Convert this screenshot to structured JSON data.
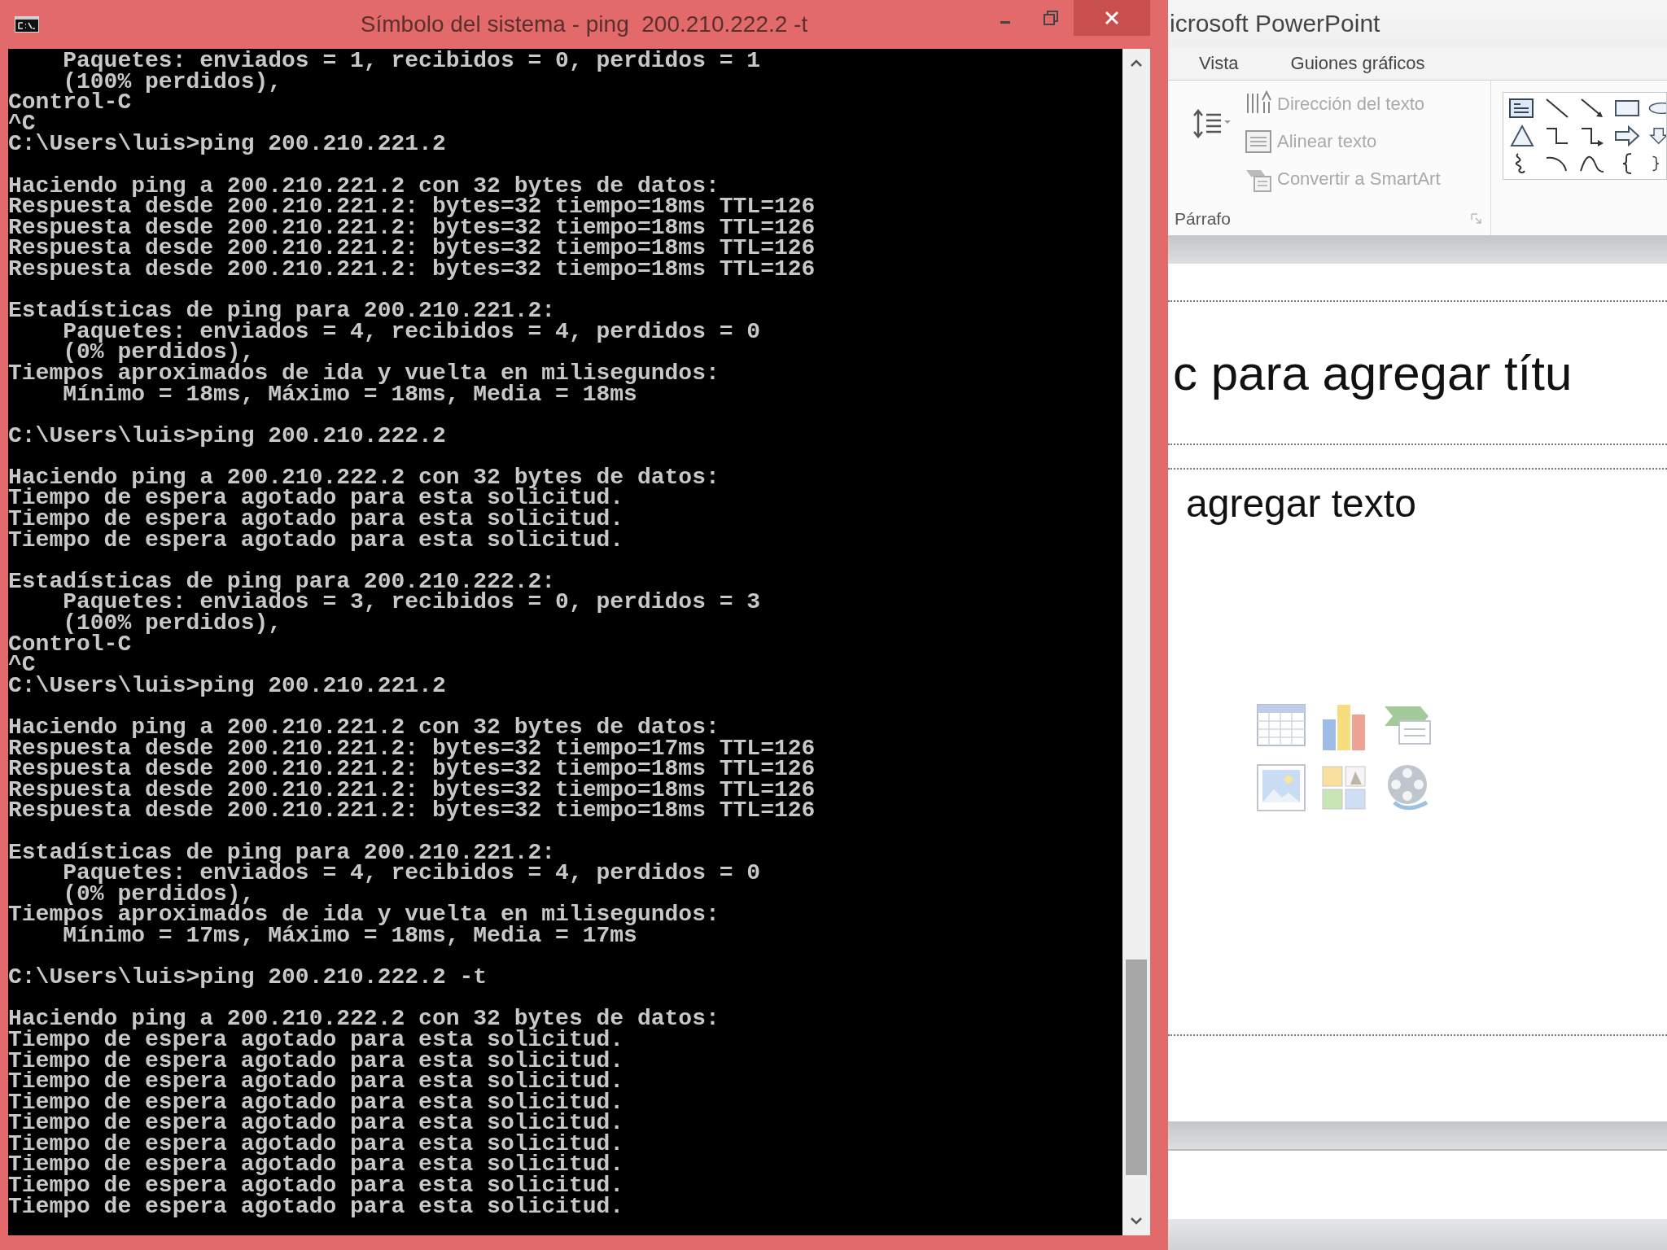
{
  "console_window": {
    "title": "Símbolo del sistema - ping  200.210.222.2 -t",
    "blocks": [
      [
        "    Paquetes: enviados = 1, recibidos = 0, perdidos = 1",
        "    (100% perdidos),",
        "Control-C",
        "^C",
        "C:\\Users\\luis>ping 200.210.221.2"
      ],
      [
        "Haciendo ping a 200.210.221.2 con 32 bytes de datos:",
        "Respuesta desde 200.210.221.2: bytes=32 tiempo=18ms TTL=126",
        "Respuesta desde 200.210.221.2: bytes=32 tiempo=18ms TTL=126",
        "Respuesta desde 200.210.221.2: bytes=32 tiempo=18ms TTL=126",
        "Respuesta desde 200.210.221.2: bytes=32 tiempo=18ms TTL=126"
      ],
      [
        "Estadísticas de ping para 200.210.221.2:",
        "    Paquetes: enviados = 4, recibidos = 4, perdidos = 0",
        "    (0% perdidos),",
        "Tiempos aproximados de ida y vuelta en milisegundos:",
        "    Mínimo = 18ms, Máximo = 18ms, Media = 18ms"
      ],
      [
        "C:\\Users\\luis>ping 200.210.222.2"
      ],
      [
        "Haciendo ping a 200.210.222.2 con 32 bytes de datos:",
        "Tiempo de espera agotado para esta solicitud.",
        "Tiempo de espera agotado para esta solicitud.",
        "Tiempo de espera agotado para esta solicitud."
      ],
      [
        "Estadísticas de ping para 200.210.222.2:",
        "    Paquetes: enviados = 3, recibidos = 0, perdidos = 3",
        "    (100% perdidos),",
        "Control-C",
        "^C",
        "C:\\Users\\luis>ping 200.210.221.2"
      ],
      [
        "Haciendo ping a 200.210.221.2 con 32 bytes de datos:",
        "Respuesta desde 200.210.221.2: bytes=32 tiempo=17ms TTL=126",
        "Respuesta desde 200.210.221.2: bytes=32 tiempo=18ms TTL=126",
        "Respuesta desde 200.210.221.2: bytes=32 tiempo=18ms TTL=126",
        "Respuesta desde 200.210.221.2: bytes=32 tiempo=18ms TTL=126"
      ],
      [
        "Estadísticas de ping para 200.210.221.2:",
        "    Paquetes: enviados = 4, recibidos = 4, perdidos = 0",
        "    (0% perdidos),",
        "Tiempos aproximados de ida y vuelta en milisegundos:",
        "    Mínimo = 17ms, Máximo = 18ms, Media = 17ms"
      ],
      [
        "C:\\Users\\luis>ping 200.210.222.2 -t"
      ],
      [
        "Haciendo ping a 200.210.222.2 con 32 bytes de datos:",
        "Tiempo de espera agotado para esta solicitud.",
        "Tiempo de espera agotado para esta solicitud.",
        "Tiempo de espera agotado para esta solicitud.",
        "Tiempo de espera agotado para esta solicitud.",
        "Tiempo de espera agotado para esta solicitud.",
        "Tiempo de espera agotado para esta solicitud.",
        "Tiempo de espera agotado para esta solicitud.",
        "Tiempo de espera agotado para esta solicitud.",
        "Tiempo de espera agotado para esta solicitud."
      ]
    ]
  },
  "powerpoint": {
    "title": "icrosoft PowerPoint",
    "tabs": [
      {
        "label": "Vista",
        "selected": false
      },
      {
        "label": "Guiones gráficos",
        "selected": false
      }
    ],
    "paragraph_group": {
      "commands": [
        {
          "kind": "text-direction",
          "label": "Dirección del texto",
          "disabled": true
        },
        {
          "kind": "align-text",
          "label": "Alinear texto",
          "disabled": true
        },
        {
          "kind": "smartart",
          "label": "Convertir a SmartArt",
          "disabled": true
        }
      ],
      "label": "Párrafo"
    },
    "slide": {
      "title_placeholder": "c para agregar títu",
      "body_placeholder": "agregar texto"
    }
  }
}
